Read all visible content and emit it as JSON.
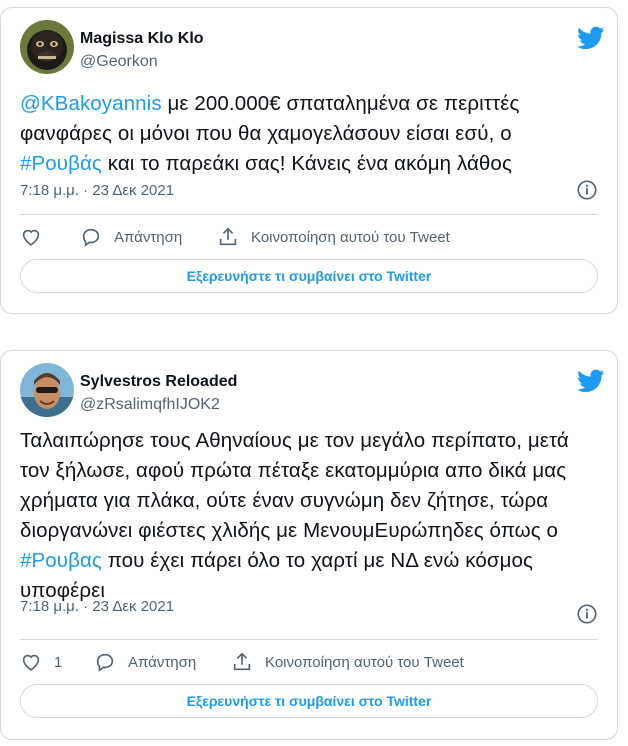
{
  "tweets": [
    {
      "author_name": "Magissa Klo Klo",
      "handle": "@Georkon",
      "text_segments": [
        {
          "text": "@KBakoyannis",
          "link": true
        },
        {
          "text": " με 200.000€ σπαταλημένα σε περιττές φανφάρες οι μόνοι που θα χαμογελάσουν είσαι εσύ, ο ",
          "link": false
        },
        {
          "text": "#Ρουβάς",
          "link": true
        },
        {
          "text": " και το παρεάκι σας! Κάνεις ένα ακόμη λάθος",
          "link": false
        }
      ],
      "timestamp": "7:18 μ.μ. · 23 Δεκ 2021",
      "like_count": "",
      "reply_label": "Απάντηση",
      "share_label": "Κοινοποίηση αυτού του Tweet",
      "explore_label": "Εξερευνήστε τι συμβαίνει στο Twitter"
    },
    {
      "author_name": "Sylvestros Reloaded",
      "handle": "@zRsalimqfhIJOK2",
      "text_segments": [
        {
          "text": "Ταλαιπώρησε τους Αθηναίους με τον μεγάλο περίπατο, μετά τον ξήλωσε, αφού πρώτα πέταξε εκατομμύρια  απο δικά μας χρήματα για πλάκα, ούτε έναν συγνώμη δεν ζήτησε, τώρα διοργανώνει φιέστες χλιδής με ΜενουμΕυρώπηδες όπως ο ",
          "link": false
        },
        {
          "text": "#Ρουβας",
          "link": true
        },
        {
          "text": " που έχει πάρει όλο το χαρτί με ΝΔ ενώ κόσμος υποφέρει",
          "link": false
        }
      ],
      "timestamp": "7:18 μ.μ. · 23 Δεκ 2021",
      "like_count": "1",
      "reply_label": "Απάντηση",
      "share_label": "Κοινοποίηση αυτού του Tweet",
      "explore_label": "Εξερευνήστε τι συμβαίνει στο Twitter"
    }
  ],
  "colors": {
    "link": "#1d9bf0",
    "secondary_text": "#536471",
    "border": "#cfd9de"
  },
  "icons": [
    "twitter-bird-icon",
    "info-icon",
    "heart-icon",
    "reply-bubble-icon",
    "share-icon"
  ]
}
